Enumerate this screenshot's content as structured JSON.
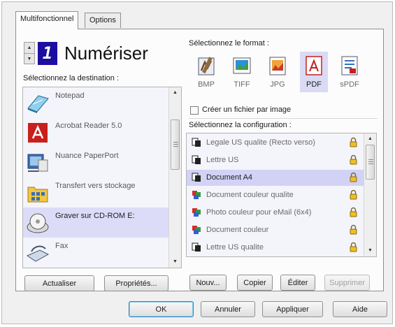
{
  "tabs": [
    {
      "label": "Multifonctionnel",
      "active": true
    },
    {
      "label": "Options",
      "active": false
    }
  ],
  "header": {
    "digit": "1",
    "title": "Numériser"
  },
  "destination": {
    "label": "Sélectionnez la destination :",
    "items": [
      {
        "label": "Notepad",
        "icon": "notepad-icon",
        "selected": false
      },
      {
        "label": "Acrobat Reader 5.0",
        "icon": "acrobat-icon",
        "selected": false
      },
      {
        "label": "Nuance PaperPort",
        "icon": "paperport-icon",
        "selected": false
      },
      {
        "label": "Transfert vers stockage",
        "icon": "storage-transfer-icon",
        "selected": false
      },
      {
        "label": "Graver sur CD-ROM  E:",
        "icon": "cd-burn-icon",
        "selected": true
      },
      {
        "label": "Fax",
        "icon": "fax-icon",
        "selected": false
      }
    ]
  },
  "format": {
    "label": "Sélectionnez le format :",
    "items": [
      {
        "label": "BMP",
        "icon": "bmp-icon",
        "selected": false
      },
      {
        "label": "TIFF",
        "icon": "tiff-icon",
        "selected": false
      },
      {
        "label": "JPG",
        "icon": "jpg-icon",
        "selected": false
      },
      {
        "label": "PDF",
        "icon": "pdf-icon",
        "selected": true
      },
      {
        "label": "sPDF",
        "icon": "spdf-icon",
        "selected": false
      }
    ],
    "checkbox_label": "Créer un fichier par image",
    "checkbox_checked": false
  },
  "configuration": {
    "label": "Sélectionnez la configuration :",
    "items": [
      {
        "label": "Legale US qualite (Recto verso)",
        "icon": "bw-document-icon",
        "selected": false
      },
      {
        "label": "Lettre US",
        "icon": "bw-document-icon",
        "selected": false
      },
      {
        "label": "Document A4",
        "icon": "bw-document-icon",
        "selected": true
      },
      {
        "label": "Document couleur qualite",
        "icon": "color-document-icon",
        "selected": false
      },
      {
        "label": "Photo couleur pour eMail (6x4)",
        "icon": "color-document-icon",
        "selected": false
      },
      {
        "label": "Document couleur",
        "icon": "color-document-icon",
        "selected": false
      },
      {
        "label": "Lettre US qualite",
        "icon": "bw-document-icon",
        "selected": false
      }
    ]
  },
  "buttons": {
    "refresh": "Actualiser",
    "properties": "Propriétés...",
    "new": "Nouv...",
    "copy": "Copier",
    "edit": "Éditer",
    "delete": "Supprimer",
    "ok": "OK",
    "cancel": "Annuler",
    "apply": "Appliquer",
    "help": "Aide"
  },
  "colors": {
    "selection": "#dcdcf8",
    "digit_bg": "#1c0ea1",
    "pdf_red": "#c8201c"
  }
}
